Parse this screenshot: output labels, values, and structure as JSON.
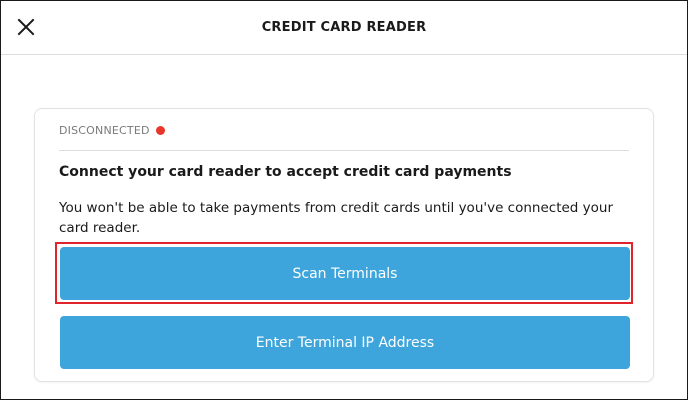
{
  "header": {
    "title": "CREDIT CARD READER",
    "close_icon": "close-icon"
  },
  "card": {
    "status": {
      "label": "DISCONNECTED",
      "dot_color": "#e8372a"
    },
    "heading": "Connect your card reader to accept credit card payments",
    "description": "You won't be able to take payments from credit cards until you've connected your card reader."
  },
  "actions": {
    "scan_label": "Scan Terminals",
    "ip_label": "Enter Terminal IP Address"
  },
  "colors": {
    "button_bg": "#3da5db",
    "highlight": "#e0242b",
    "text": "#1a1a1a",
    "muted": "#7a7a7a"
  }
}
